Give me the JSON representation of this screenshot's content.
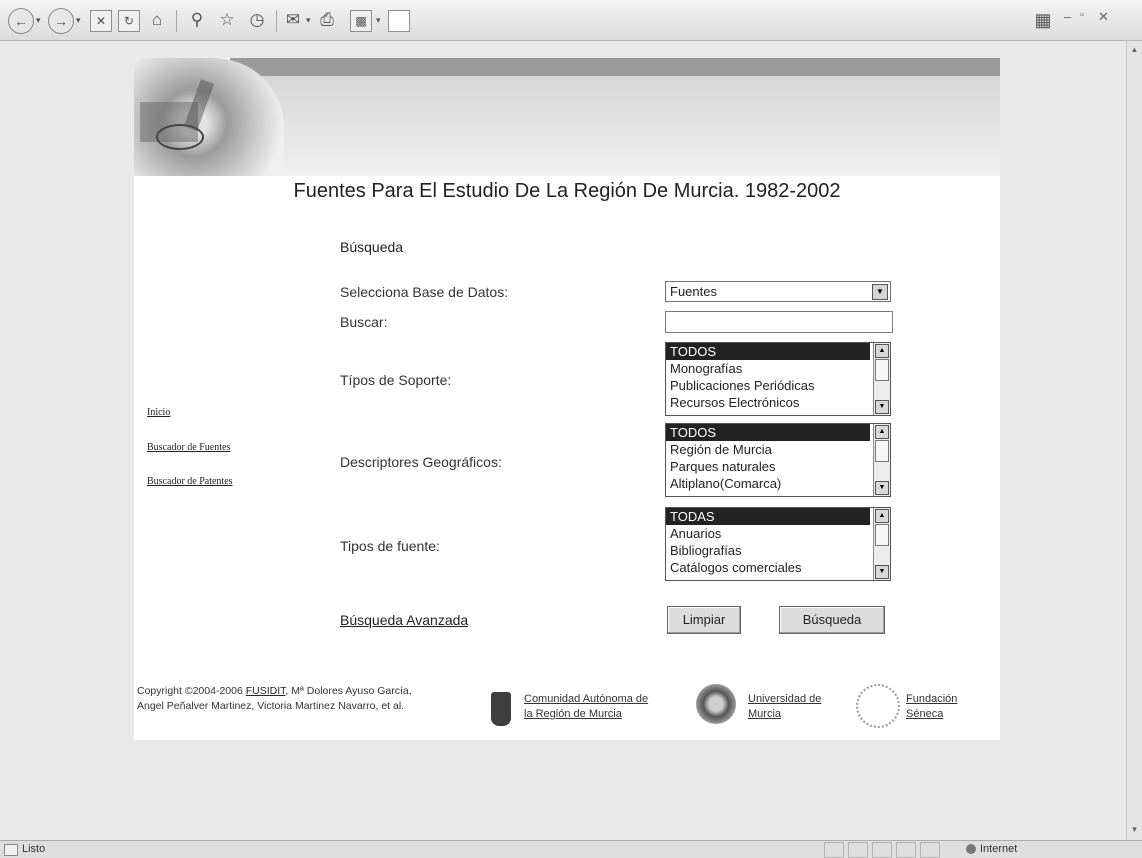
{
  "browser": {
    "status": "Listo",
    "zone": "Internet"
  },
  "header": {
    "title": "Fuentes Para El Estudio De La Región De Murcia. 1982-2002"
  },
  "sidenav": {
    "items": [
      "Inicio",
      "Buscador de Fuentes",
      "Buscador de Patentes"
    ]
  },
  "form": {
    "section": "Búsqueda",
    "db_label": "Selecciona Base de Datos:",
    "db_value": "Fuentes",
    "search_label": "Buscar:",
    "search_value": "",
    "support_label": "Típos de Soporte:",
    "support_options": [
      "TODOS",
      "Monografías",
      "Publicaciones Periódicas",
      "Recursos Electrónicos"
    ],
    "geo_label": "Descriptores Geográficos:",
    "geo_options": [
      "TODOS",
      "Región de Murcia",
      "Parques naturales",
      "Altiplano(Comarca)"
    ],
    "source_label": "Tipos de fuente:",
    "source_options": [
      "TODAS",
      "Anuarios",
      "Bibliografías",
      "Catálogos comerciales"
    ],
    "advanced_link": "Búsqueda Avanzada",
    "clear_button": "Limpiar",
    "search_button": "Búsqueda"
  },
  "footer": {
    "copyright_prefix": "Copyright ©2004-2006",
    "copyright_link": "FUSIDIT",
    "copyright_rest": ", Mª Dolores Ayuso García, Angel Peñalver Martinez, Victoria Martinez Navarro, et al.",
    "link1_line1": "Comunidad Autónoma de",
    "link1_line2": "la Región de Murcia",
    "link2_line1": "Universidad de",
    "link2_line2": "Murcia",
    "link3_line1": "Fundación",
    "link3_line2": "Séneca"
  },
  "icons": [
    "back-icon",
    "forward-icon",
    "stop-icon",
    "refresh-icon",
    "home-icon",
    "search-icon",
    "favorites-icon",
    "history-icon",
    "mail-icon",
    "print-icon",
    "edit-icon",
    "windows-logo-icon"
  ]
}
